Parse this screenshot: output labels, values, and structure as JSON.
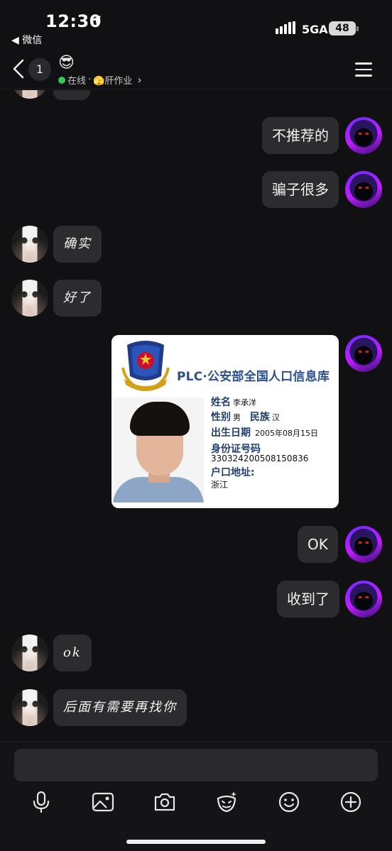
{
  "status_bar": {
    "time": "12:30",
    "back_app": "◀ 微信",
    "network": "5GA",
    "battery": "48"
  },
  "header": {
    "unread_count": "1",
    "contact_emoji": "😎",
    "presence": "在线",
    "separator": "·",
    "activity": "🫣肝作业",
    "chevron": "›"
  },
  "messages": [
    {
      "side": "right",
      "text": "不推荐的"
    },
    {
      "side": "right",
      "text": "骗子很多"
    },
    {
      "side": "left",
      "text": "确实"
    },
    {
      "side": "left",
      "text": "好了"
    },
    {
      "side": "right",
      "type": "image"
    },
    {
      "side": "right",
      "text": "OK"
    },
    {
      "side": "right",
      "text": "收到了"
    },
    {
      "side": "left",
      "text": "ok"
    },
    {
      "side": "left",
      "text": "后面有需要再找你"
    }
  ],
  "id_card": {
    "title": "PLC·公安部全国人口信息库",
    "name_label": "姓名",
    "name": "李承洋",
    "gender_label": "性别",
    "gender": "男",
    "ethnicity_label": "民族",
    "ethnicity": "汉",
    "dob_label": "出生日期",
    "dob": "2005年08月15日",
    "id_label": "身份证号码",
    "id_number": "330324200508150836",
    "address_label": "户口地址:",
    "address": "浙江"
  },
  "composer": {
    "placeholder": "",
    "icons": [
      "microphone-icon",
      "image-icon",
      "camera-icon",
      "sticker-icon",
      "emoji-icon",
      "plus-icon"
    ]
  }
}
